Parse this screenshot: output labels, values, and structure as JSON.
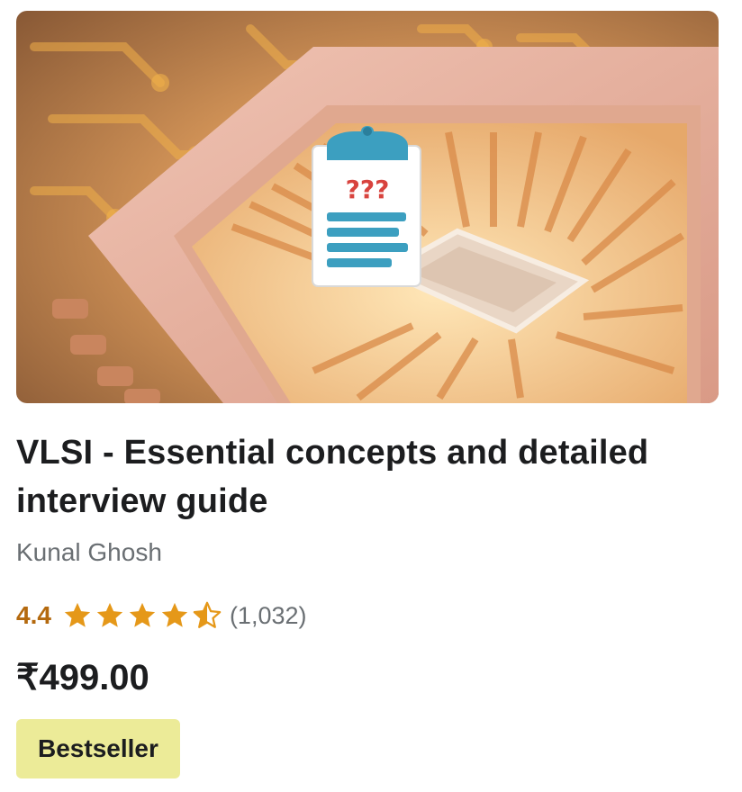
{
  "course": {
    "title": "VLSI - Essential concepts and detailed interview guide",
    "instructor": "Kunal Ghosh",
    "rating": "4.4",
    "rating_stars": 4.4,
    "rating_count": "(1,032)",
    "price": "₹499.00",
    "badge": "Bestseller"
  },
  "thumbnail": {
    "icon": "clipboard-question-icon",
    "question_marks": "???",
    "colors": {
      "background": "#c98a55",
      "chip_frame": "#e8b3a2",
      "clipboard_clip": "#3c9fc0",
      "question_marks": "#d8433e",
      "lines": "#3c9fc0"
    }
  },
  "colors": {
    "rating_text": "#b4690e",
    "star": "#e59819",
    "muted_text": "#6a6f73",
    "badge_bg": "#eceb98"
  }
}
